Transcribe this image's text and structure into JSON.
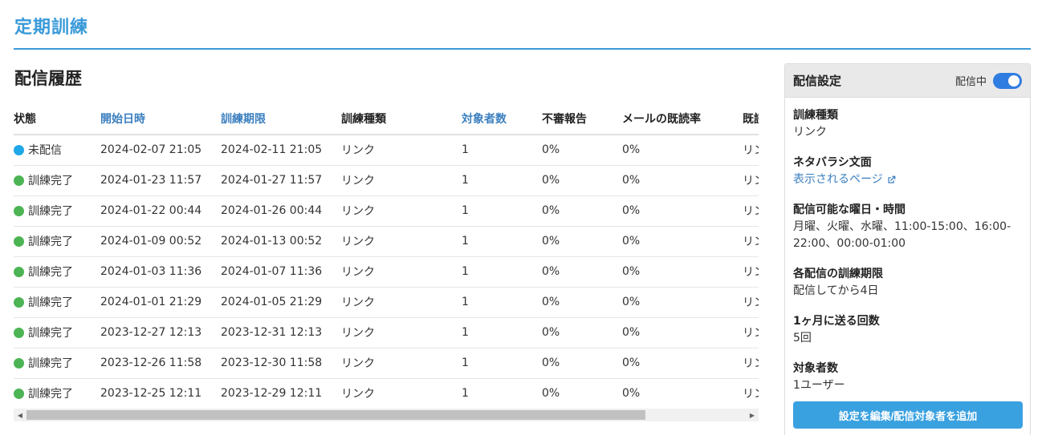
{
  "page": {
    "title": "定期訓練"
  },
  "history": {
    "title": "配信履歴",
    "columns": [
      {
        "label": "状態",
        "sortable": false
      },
      {
        "label": "開始日時",
        "sortable": true
      },
      {
        "label": "訓練期限",
        "sortable": true
      },
      {
        "label": "訓練種類",
        "sortable": false
      },
      {
        "label": "対象者数",
        "sortable": true
      },
      {
        "label": "不審報告",
        "sortable": false
      },
      {
        "label": "メールの既読率",
        "sortable": false
      },
      {
        "label": "既読",
        "sortable": false
      }
    ],
    "status_colors": {
      "未配信": "#1fa8e8",
      "訓練完了": "#4cb454"
    },
    "rows": [
      {
        "status": "未配信",
        "start": "2024-02-07 21:05",
        "deadline": "2024-02-11 21:05",
        "type": "リンク",
        "targets": "1",
        "reports": "0%",
        "read_rate": "0%",
        "cut": "リン"
      },
      {
        "status": "訓練完了",
        "start": "2024-01-23 11:57",
        "deadline": "2024-01-27 11:57",
        "type": "リンク",
        "targets": "1",
        "reports": "0%",
        "read_rate": "0%",
        "cut": "リン"
      },
      {
        "status": "訓練完了",
        "start": "2024-01-22 00:44",
        "deadline": "2024-01-26 00:44",
        "type": "リンク",
        "targets": "1",
        "reports": "0%",
        "read_rate": "0%",
        "cut": "リン"
      },
      {
        "status": "訓練完了",
        "start": "2024-01-09 00:52",
        "deadline": "2024-01-13 00:52",
        "type": "リンク",
        "targets": "1",
        "reports": "0%",
        "read_rate": "0%",
        "cut": "リン"
      },
      {
        "status": "訓練完了",
        "start": "2024-01-03 11:36",
        "deadline": "2024-01-07 11:36",
        "type": "リンク",
        "targets": "1",
        "reports": "0%",
        "read_rate": "0%",
        "cut": "リン"
      },
      {
        "status": "訓練完了",
        "start": "2024-01-01 21:29",
        "deadline": "2024-01-05 21:29",
        "type": "リンク",
        "targets": "1",
        "reports": "0%",
        "read_rate": "0%",
        "cut": "リン"
      },
      {
        "status": "訓練完了",
        "start": "2023-12-27 12:13",
        "deadline": "2023-12-31 12:13",
        "type": "リンク",
        "targets": "1",
        "reports": "0%",
        "read_rate": "0%",
        "cut": "リン"
      },
      {
        "status": "訓練完了",
        "start": "2023-12-26 11:58",
        "deadline": "2023-12-30 11:58",
        "type": "リンク",
        "targets": "1",
        "reports": "0%",
        "read_rate": "0%",
        "cut": "リン"
      },
      {
        "status": "訓練完了",
        "start": "2023-12-25 12:11",
        "deadline": "2023-12-29 12:11",
        "type": "リンク",
        "targets": "1",
        "reports": "0%",
        "read_rate": "0%",
        "cut": "リン"
      }
    ],
    "scroll_position": 0.0,
    "scroll_visible_fraction": 0.86
  },
  "settings": {
    "title": "配信設定",
    "toggle_label": "配信中",
    "toggle_on": true,
    "fields": {
      "type_label": "訓練種類",
      "type_value": "リンク",
      "reveal_label": "ネタバラシ文面",
      "reveal_link": "表示されるページ",
      "schedule_label": "配信可能な曜日・時間",
      "schedule_value": "月曜、火曜、水曜、11:00-15:00、16:00-22:00、00:00-01:00",
      "deadline_label": "各配信の訓練期限",
      "deadline_value": "配信してから4日",
      "count_label": "1ヶ月に送る回数",
      "count_value": "5回",
      "targets_label": "対象者数",
      "targets_value": "1ユーザー"
    },
    "edit_button": "設定を編集/配信対象者を追加"
  },
  "colors": {
    "accent": "#3a9ad9",
    "link": "#3b7fbf",
    "toggle": "#2f7de1",
    "button": "#3aa1e0"
  },
  "icons": {
    "external_link": "external-link-icon",
    "scroll_left": "scroll-left-arrow-icon",
    "scroll_right": "scroll-right-arrow-icon"
  }
}
